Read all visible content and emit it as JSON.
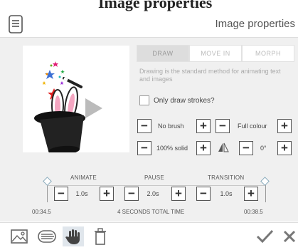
{
  "top_strip": {
    "text": "Image properties"
  },
  "header": {
    "title": "Image properties",
    "menu_icon": "document-menu-icon"
  },
  "tabs": [
    {
      "label": "DRAW",
      "active": true
    },
    {
      "label": "MOVE IN",
      "active": false
    },
    {
      "label": "MORPH",
      "active": false
    }
  ],
  "description": "Drawing is the standard method for animating text and images",
  "only_draw_strokes": {
    "label": "Only draw strokes?",
    "checked": false
  },
  "brush": {
    "value": "No brush"
  },
  "colour": {
    "value": "Full colour"
  },
  "opacity": {
    "value": "100% solid"
  },
  "angle": {
    "value": "0°",
    "icon": "mirror-triangle-icon"
  },
  "timeline": {
    "animate": {
      "label": "ANIMATE",
      "value": "1.0s"
    },
    "pause": {
      "label": "PAUSE",
      "value": "2.0s"
    },
    "transition": {
      "label": "TRANSITION",
      "value": "1.0s"
    },
    "start_time": "00:34.5",
    "end_time": "00:38.5",
    "total": "4 SECONDS TOTAL TIME"
  },
  "footer": {
    "icons": [
      "image-icon",
      "text-lines-icon",
      "hand-icon",
      "trash-icon",
      "check-icon",
      "close-icon"
    ],
    "selected": "hand-icon"
  },
  "colors": {
    "accent_selected": "#e0e6ec",
    "panel_bg": "#f0f0f0"
  }
}
